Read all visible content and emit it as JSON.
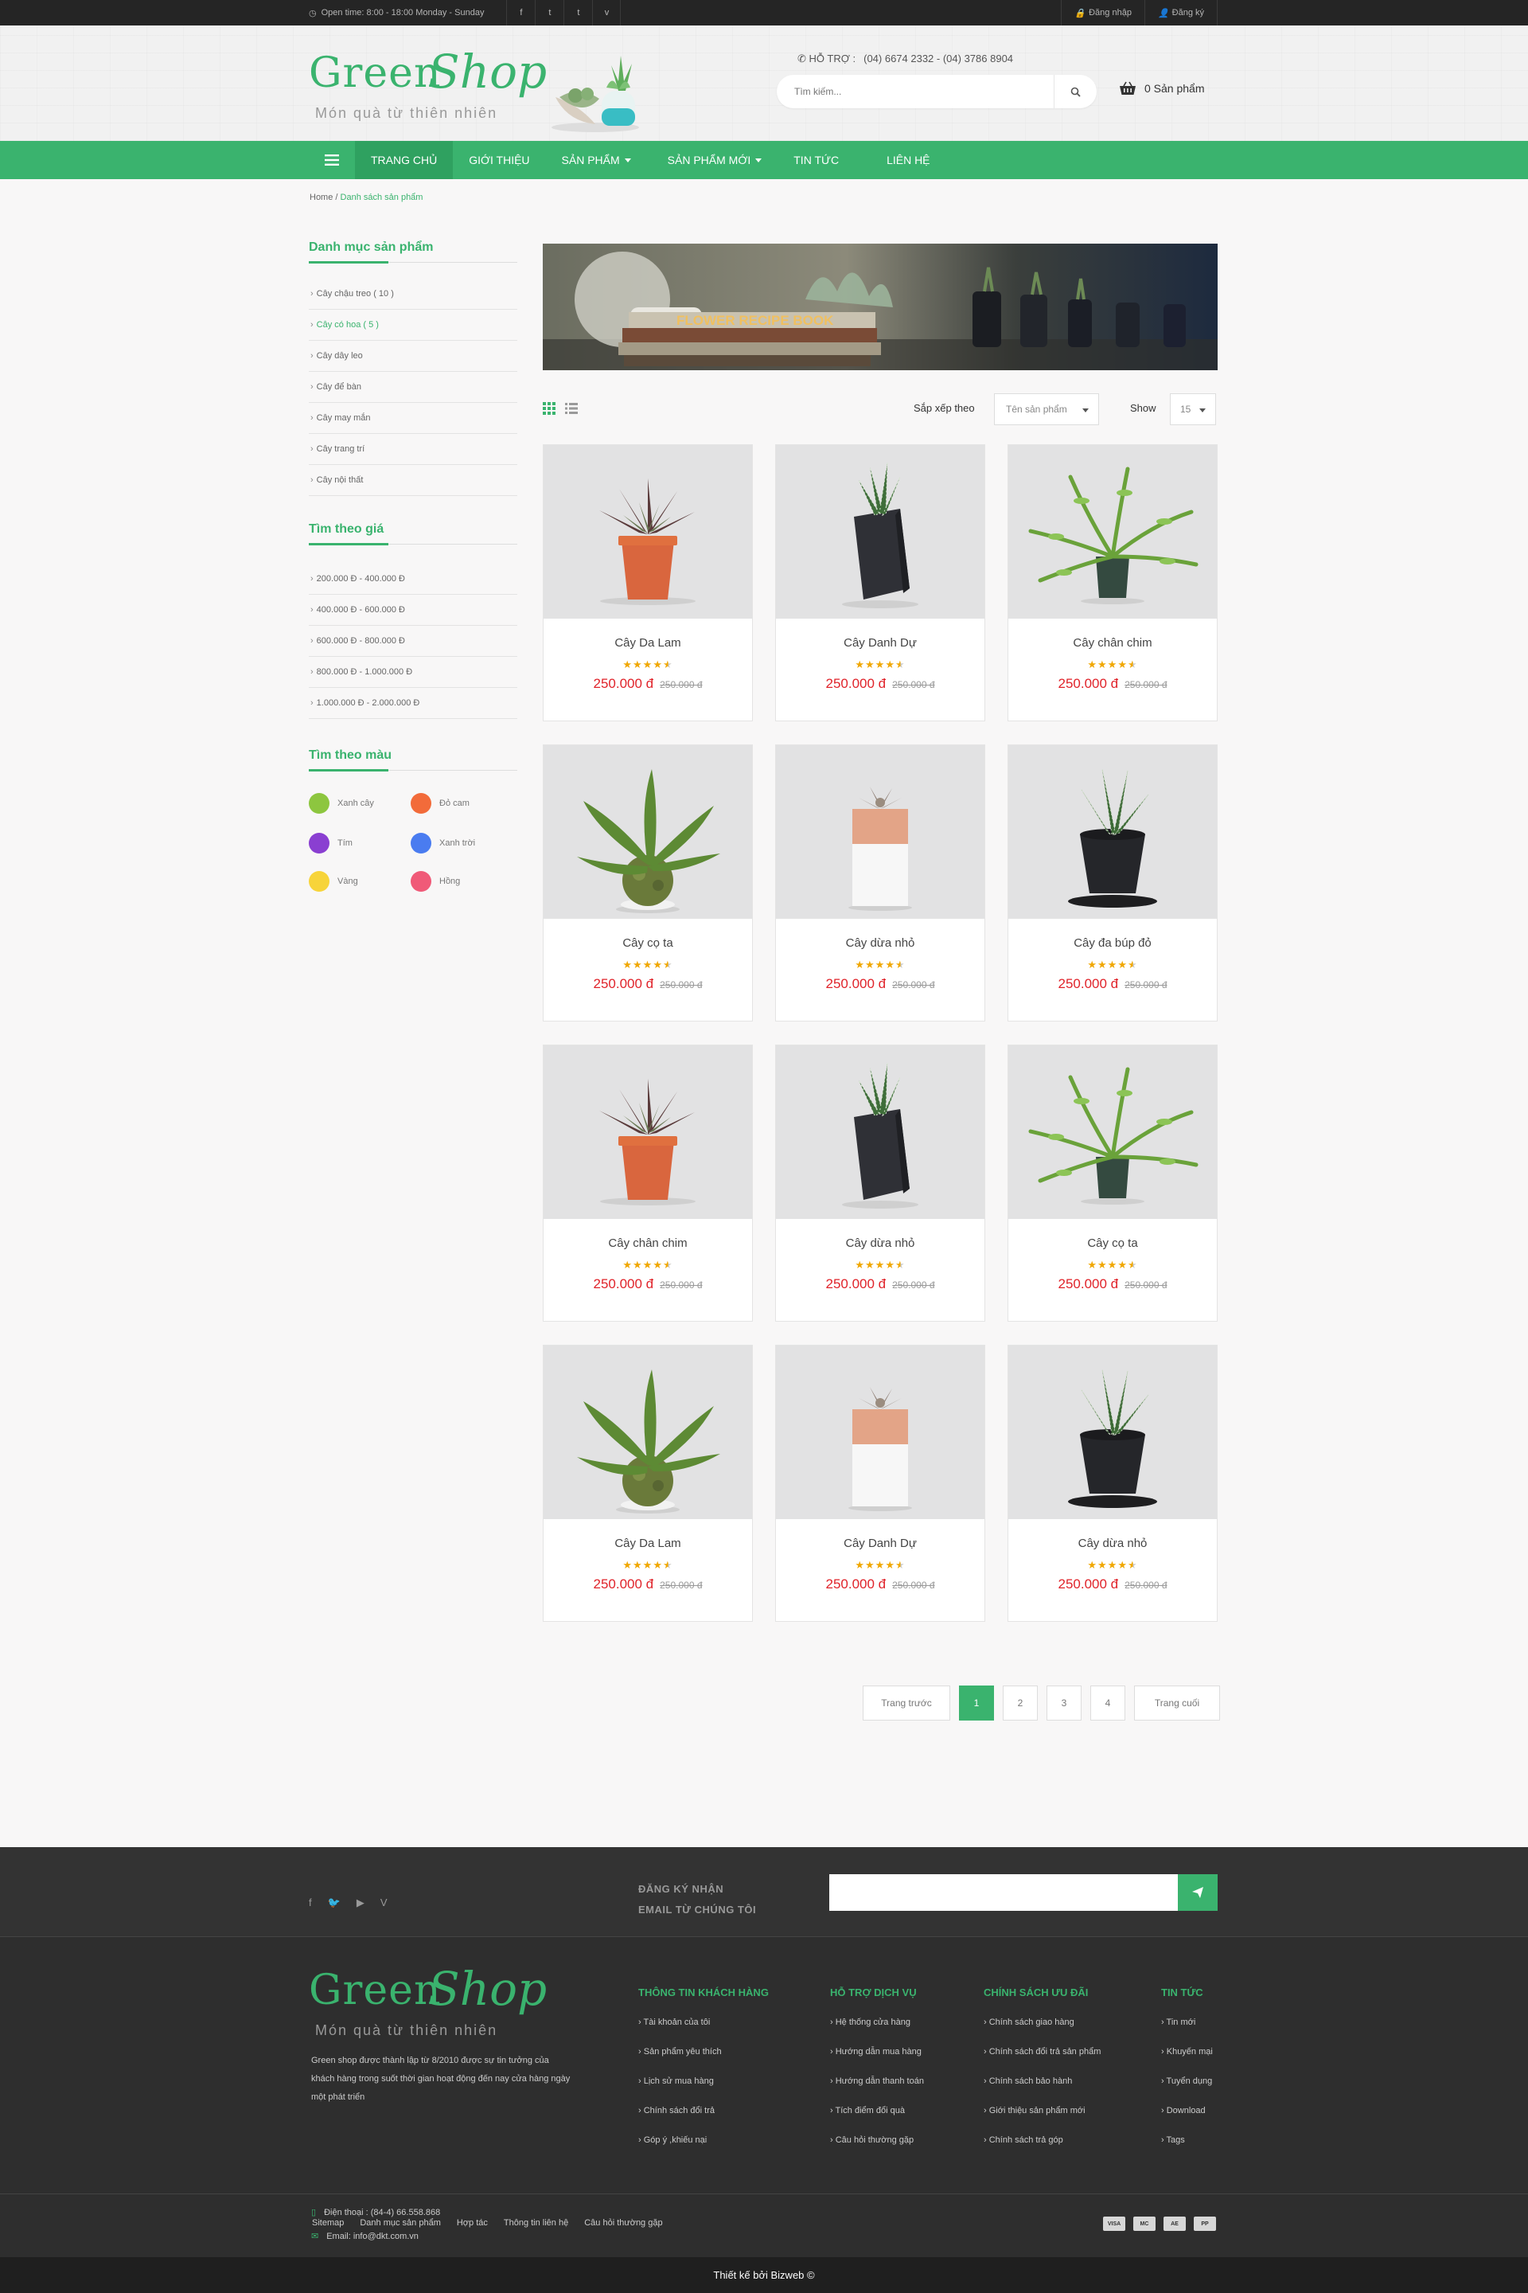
{
  "topbar": {
    "hours": "Open time: 8:00 - 18:00   Monday - Sunday",
    "social": [
      "f",
      "t",
      "t",
      "v"
    ],
    "login": "Đăng nhập",
    "register": "Đăng ký"
  },
  "header": {
    "logo_green": "Green",
    "logo_shop": "Shop",
    "logo_tagline": "Món quà từ thiên nhiên",
    "support_label": "HỖ TRỢ :",
    "support_phones": "(04) 6674 2332 - (04) 3786 8904",
    "search_placeholder": "Tìm kiếm...",
    "cart_label": "0 Sản phẩm"
  },
  "nav": {
    "items": [
      {
        "label": "TRANG CHỦ",
        "active": true
      },
      {
        "label": "GIỚI THIỆU"
      },
      {
        "label": "SẢN PHẨM",
        "dropdown": true
      },
      {
        "label": "SẢN PHẨM MỚI",
        "dropdown": true
      },
      {
        "label": "TIN TỨC"
      },
      {
        "label": "LIÊN HỆ"
      }
    ]
  },
  "breadcrumb": {
    "home": "Home",
    "sep": " / ",
    "current": "Danh sách sản phẩm"
  },
  "sidebar": {
    "categories_title": "Danh mục sản phẩm",
    "categories": [
      "Cây chậu treo ( 10 )",
      "Cây có hoa ( 5 )",
      "Cây dây leo",
      "Cây để bàn",
      "Cây may mắn",
      "Cây trang trí",
      "Cây nội thất"
    ],
    "price_title": "Tìm theo giá",
    "prices": [
      "200.000 Đ - 400.000 Đ",
      "400.000 Đ - 600.000 Đ",
      "600.000 Đ - 800.000 Đ",
      "800.000 Đ - 1.000.000 Đ",
      "1.000.000 Đ - 2.000.000 Đ"
    ],
    "color_title": "Tìm theo màu",
    "colors": [
      {
        "label": "Xanh cây",
        "hex": "#8dc63f"
      },
      {
        "label": "Đỏ cam",
        "hex": "#f26b3a"
      },
      {
        "label": "Tím",
        "hex": "#8a3fd1"
      },
      {
        "label": "Xanh trời",
        "hex": "#4a7cf0"
      },
      {
        "label": "Vàng",
        "hex": "#f7d43a"
      },
      {
        "label": "Hồng",
        "hex": "#f05a78"
      }
    ]
  },
  "toolbar": {
    "sort_label": "Sắp xếp theo",
    "sort_value": "Tên sản phẩm",
    "show_label": "Show",
    "show_value": "15"
  },
  "products": [
    {
      "name": "Cây Da Lam",
      "price": "250.000 đ",
      "old_price": "250.000 đ",
      "rating": 4.5,
      "image": "succulent-orange-pot"
    },
    {
      "name": "Cây Danh Dự",
      "price": "250.000 đ",
      "old_price": "250.000 đ",
      "rating": 4.5,
      "image": "haworthia-black-square"
    },
    {
      "name": "Cây chân chim",
      "price": "250.000 đ",
      "old_price": "250.000 đ",
      "rating": 4.5,
      "image": "fern-dark-pot"
    },
    {
      "name": "Cây cọ ta",
      "price": "250.000 đ",
      "old_price": "250.000 đ",
      "rating": 4.5,
      "image": "staghorn-kokedama"
    },
    {
      "name": "Cây dừa nhỏ",
      "price": "250.000 đ",
      "old_price": "250.000 đ",
      "rating": 4.5,
      "image": "succulent-white-pink-pot"
    },
    {
      "name": "Cây đa búp đỏ",
      "price": "250.000 đ",
      "old_price": "250.000 đ",
      "rating": 4.5,
      "image": "aloe-black-round"
    },
    {
      "name": "Cây chân chim",
      "price": "250.000 đ",
      "old_price": "250.000 đ",
      "rating": 4.5,
      "image": "succulent-orange-pot"
    },
    {
      "name": "Cây dừa nhỏ",
      "price": "250.000 đ",
      "old_price": "250.000 đ",
      "rating": 4.5,
      "image": "haworthia-black-square"
    },
    {
      "name": "Cây cọ ta",
      "price": "250.000 đ",
      "old_price": "250.000 đ",
      "rating": 4.5,
      "image": "fern-dark-pot"
    },
    {
      "name": "Cây Da Lam",
      "price": "250.000 đ",
      "old_price": "250.000 đ",
      "rating": 4.5,
      "image": "staghorn-kokedama"
    },
    {
      "name": "Cây Danh Dự",
      "price": "250.000 đ",
      "old_price": "250.000 đ",
      "rating": 4.5,
      "image": "succulent-white-pink-pot"
    },
    {
      "name": "Cây dừa nhỏ",
      "price": "250.000 đ",
      "old_price": "250.000 đ",
      "rating": 4.5,
      "image": "aloe-black-round"
    }
  ],
  "banner": {
    "book_text": "FLOWER RECIPE BOOK"
  },
  "pagination": {
    "prev": "Trang trước",
    "pages": [
      "1",
      "2",
      "3",
      "4"
    ],
    "current": "1",
    "last": "Trang cuối"
  },
  "footer": {
    "newsletter_line1": "ĐĂNG KÝ NHẬN",
    "newsletter_line2": "EMAIL TỪ CHÚNG TÔI",
    "about": "Green shop được thành lập từ 8/2010 được sự tin tưởng của khách hàng trong suốt thời gian hoạt động đến nay cửa hàng ngày một phát triển",
    "phone": "Điện thoại : (84-4) 66.558.868",
    "email": "Email: info@dkt.com.vn",
    "columns": [
      {
        "title": "THÔNG TIN KHÁCH HÀNG",
        "items": [
          "Tài khoản của tôi",
          "Sản phẩm yêu thích",
          "Lịch sử mua hàng",
          "Chính sách đổi trả",
          "Góp ý ,khiếu nại"
        ]
      },
      {
        "title": "HỖ TRỢ DỊCH VỤ",
        "items": [
          "Hệ thống cửa hàng",
          "Hướng dẫn mua hàng",
          "Hướng dẫn thanh toán",
          "Tích điểm đổi quà",
          "Câu hỏi thường gặp"
        ]
      },
      {
        "title": "CHÍNH SÁCH ƯU ĐÃI",
        "items": [
          "Chính sách giao hàng",
          "Chính sách đổi trả sản phẩm",
          "Chính sách bảo hành",
          "Giới thiệu sản phẩm mới",
          "Chính sách trả góp"
        ]
      },
      {
        "title": "TIN TỨC",
        "items": [
          "Tin mới",
          "Khuyến mại",
          "Tuyển dụng",
          "Download",
          "Tags"
        ]
      }
    ],
    "bottom_links": [
      "Sitemap",
      "Danh mục sản phẩm",
      "Hợp tác",
      "Thông tin liên hệ",
      "Câu hỏi thường gặp"
    ],
    "payments": [
      "VISA",
      "MC",
      "AE",
      "PP"
    ],
    "copyright": "Thiết kế  bởi Bizweb ©"
  }
}
